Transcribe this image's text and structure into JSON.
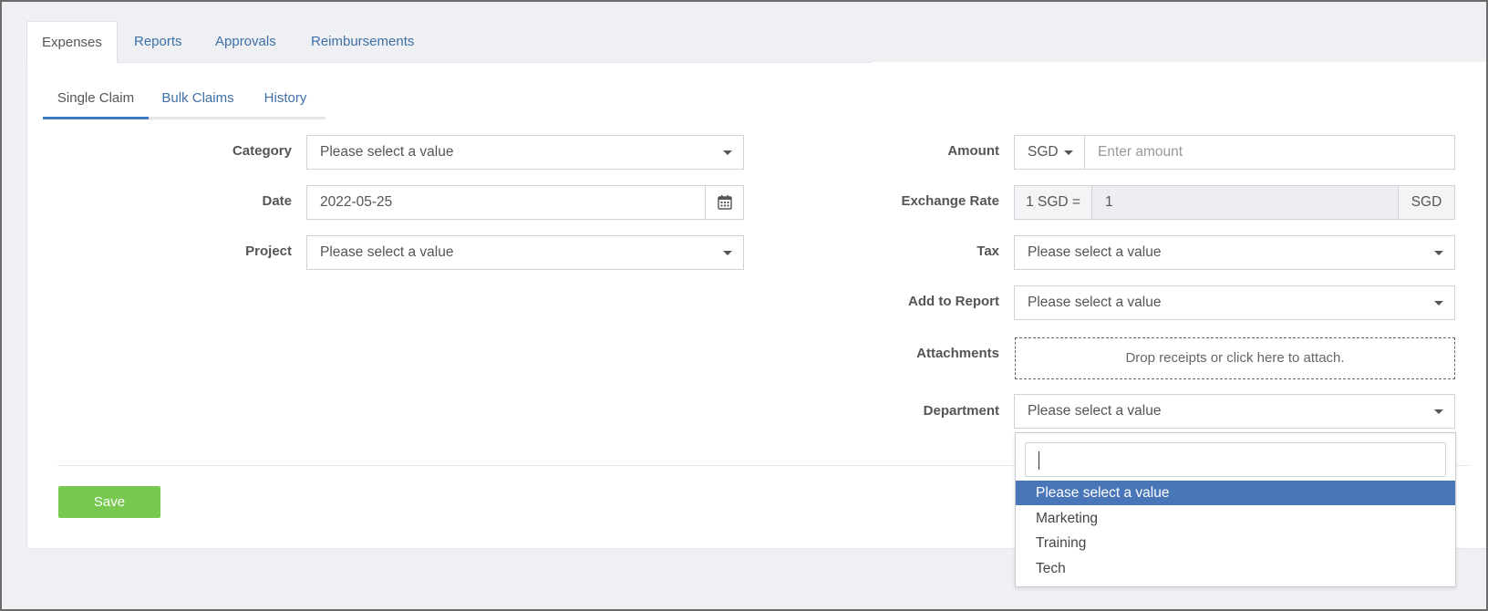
{
  "tabs": {
    "expenses": "Expenses",
    "reports": "Reports",
    "approvals": "Approvals",
    "reimbursements": "Reimbursements"
  },
  "subtabs": {
    "single_claim": "Single Claim",
    "bulk_claims": "Bulk Claims",
    "history": "History"
  },
  "form": {
    "category": {
      "label": "Category",
      "value": "Please select a value"
    },
    "date": {
      "label": "Date",
      "value": "2022-05-25",
      "icon": "calendar-icon"
    },
    "project": {
      "label": "Project",
      "value": "Please select a value"
    },
    "amount": {
      "label": "Amount",
      "currency": "SGD",
      "placeholder": "Enter amount"
    },
    "exchange_rate": {
      "label": "Exchange Rate",
      "prefix": "1 SGD =",
      "value": "1",
      "suffix": "SGD"
    },
    "tax": {
      "label": "Tax",
      "value": "Please select a value"
    },
    "add_to_report": {
      "label": "Add to Report",
      "value": "Please select a value"
    },
    "attachments": {
      "label": "Attachments",
      "dropzone": "Drop receipts or click here to attach."
    },
    "department": {
      "label": "Department",
      "value": "Please select a value"
    }
  },
  "dropdown": {
    "search_value": "",
    "options": [
      "Please select a value",
      "Marketing",
      "Training",
      "Tech"
    ],
    "selected_index": 0
  },
  "actions": {
    "save": "Save"
  },
  "colors": {
    "accent": "#3f7ac1",
    "save": "#77c84e",
    "selected_option": "#4876b8"
  }
}
